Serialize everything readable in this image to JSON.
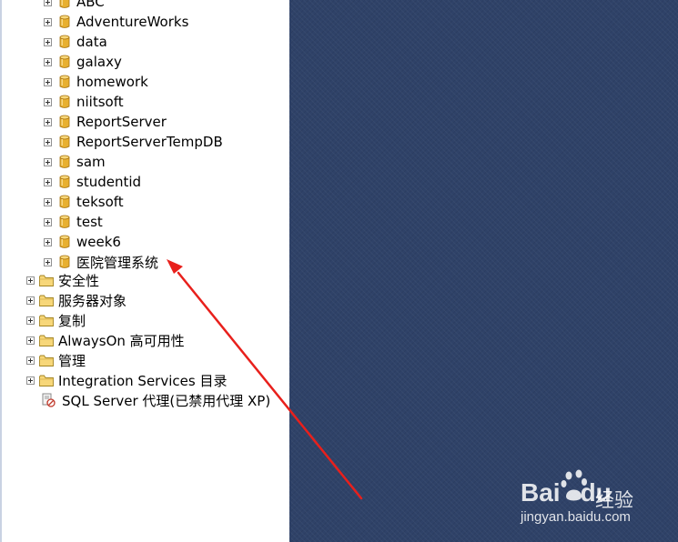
{
  "object_explorer": {
    "databases": [
      {
        "name": "ABC"
      },
      {
        "name": "AdventureWorks"
      },
      {
        "name": "data"
      },
      {
        "name": "galaxy"
      },
      {
        "name": "homework"
      },
      {
        "name": "niitsoft"
      },
      {
        "name": "ReportServer"
      },
      {
        "name": "ReportServerTempDB"
      },
      {
        "name": "sam"
      },
      {
        "name": "studentid"
      },
      {
        "name": "teksoft"
      },
      {
        "name": "test"
      },
      {
        "name": "week6"
      },
      {
        "name": "医院管理系统"
      }
    ],
    "folders": [
      {
        "name": "安全性",
        "icon": "folder-icon"
      },
      {
        "name": "服务器对象",
        "icon": "folder-icon"
      },
      {
        "name": "复制",
        "icon": "folder-icon"
      },
      {
        "name": "AlwaysOn 高可用性",
        "icon": "folder-icon"
      },
      {
        "name": "管理",
        "icon": "folder-icon"
      },
      {
        "name": "Integration Services 目录",
        "icon": "folder-icon"
      }
    ],
    "agent": {
      "name": "SQL Server 代理(已禁用代理 XP)",
      "icon": "sql-agent-disabled-icon"
    }
  },
  "annotation": {
    "type": "red-arrow",
    "color": "#e8201c",
    "target": "医院管理系统"
  },
  "watermark": {
    "logo": "Bai",
    "logo_tail": "du",
    "cn": "经验",
    "url": "jingyan.baidu.com"
  },
  "colors": {
    "document_area": "#2f4268",
    "tree_background": "#ffffff",
    "db_icon": "#e8b030"
  }
}
